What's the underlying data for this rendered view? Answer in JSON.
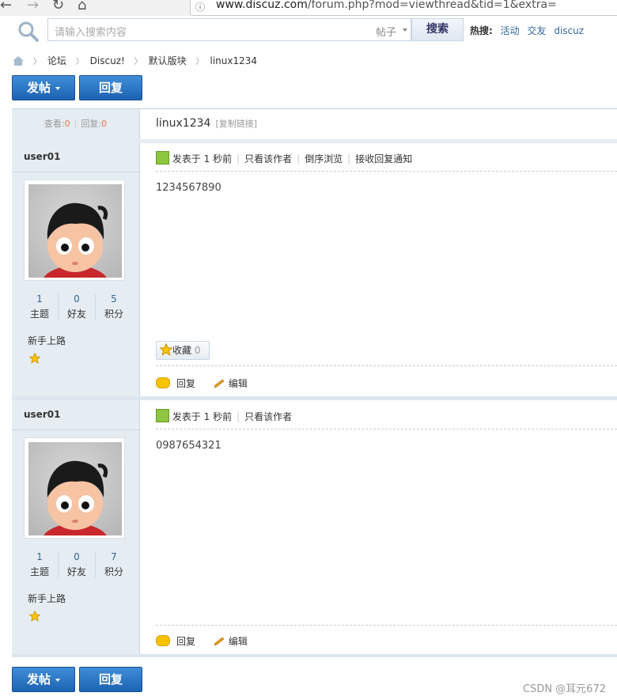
{
  "browser": {
    "url_host": "www.discuz.com",
    "url_rest": "/forum.php?mod=viewthread&tid=1&extra="
  },
  "search": {
    "placeholder": "请输入搜索内容",
    "type_label": "帖子",
    "button_label": "搜索",
    "hot_label": "热搜:",
    "hot_terms": [
      "活动",
      "交友",
      "discuz"
    ]
  },
  "breadcrumb": [
    "论坛",
    "Discuz!",
    "默认版块",
    "linux1234"
  ],
  "toolbar": {
    "post_label": "发帖",
    "reply_label": "回复"
  },
  "thread": {
    "views_label": "查看:",
    "views": "0",
    "replies_label": "回复:",
    "replies": "0",
    "title": "linux1234",
    "copy_link": "[复制链接]"
  },
  "posts": [
    {
      "author": "user01",
      "stats": [
        {
          "num": "1",
          "label": "主题"
        },
        {
          "num": "0",
          "label": "好友"
        },
        {
          "num": "5",
          "label": "积分"
        }
      ],
      "rank": "新手上路",
      "posted": "发表于 1 秒前",
      "meta_links": [
        "只看该作者",
        "倒序浏览",
        "接收回复通知"
      ],
      "content": "1234567890",
      "fav_label": "收藏",
      "fav_count": "0",
      "actions": [
        "回复",
        "编辑"
      ]
    },
    {
      "author": "user01",
      "stats": [
        {
          "num": "1",
          "label": "主题"
        },
        {
          "num": "0",
          "label": "好友"
        },
        {
          "num": "7",
          "label": "积分"
        }
      ],
      "rank": "新手上路",
      "posted": "发表于 1 秒前",
      "meta_links": [
        "只看该作者"
      ],
      "content": "0987654321",
      "actions": [
        "回复",
        "编辑"
      ]
    }
  ],
  "watermark": "CSDN @耳元672",
  "colors": {
    "button_blue": "#2a6fc0",
    "link": "#336699",
    "count_red": "#f26c4f"
  }
}
